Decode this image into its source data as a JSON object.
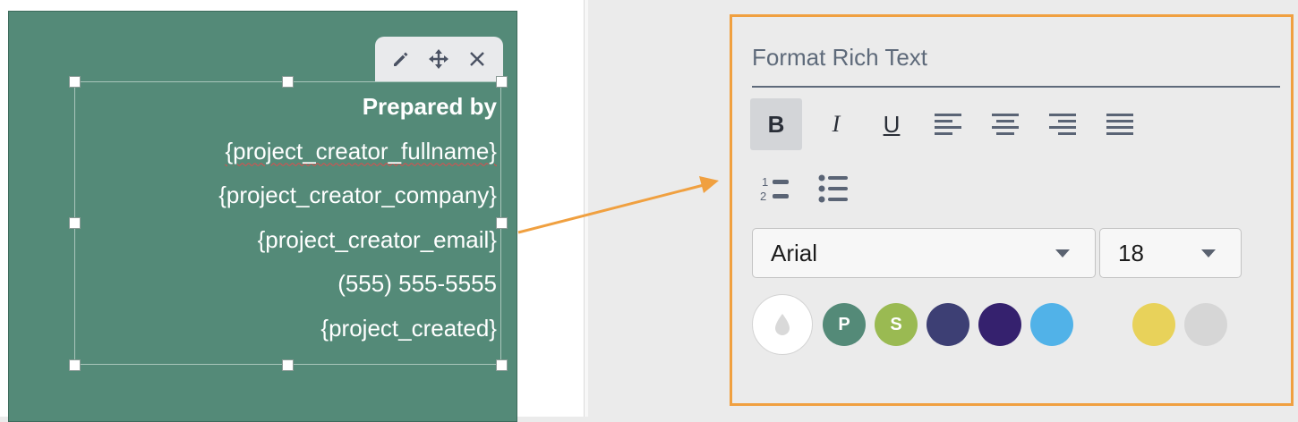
{
  "slide": {
    "toolbar": {
      "edit_icon": "pencil-icon",
      "move_icon": "move-icon",
      "close_icon": "close-icon"
    },
    "lines": [
      "Prepared by",
      "{project_creator_fullname}",
      "{project_creator_company}",
      "{project_creator_email}",
      "(555) 555-5555",
      "{project_created}"
    ],
    "background_color": "#548a78"
  },
  "panel": {
    "title": "Format Rich Text",
    "format_buttons": {
      "bold": "B",
      "italic": "I",
      "underline": "U",
      "align_left": "align-left-icon",
      "align_center": "align-center-icon",
      "align_right": "align-right-icon",
      "justify": "align-justify-icon",
      "ordered_list": "ordered-list-icon",
      "bullet_list": "bullet-list-icon"
    },
    "font": {
      "value": "Arial"
    },
    "size": {
      "value": "18"
    },
    "swatches": [
      {
        "label": "",
        "color": "#ffffff",
        "icon": "droplet-icon"
      },
      {
        "label": "P",
        "color": "#548a78"
      },
      {
        "label": "S",
        "color": "#9aba52"
      },
      {
        "label": "",
        "color": "#3d3f74"
      },
      {
        "label": "",
        "color": "#35216e"
      },
      {
        "label": "",
        "color": "#51b2e8"
      },
      {
        "label": "",
        "color": "#e8d25a"
      },
      {
        "label": "",
        "color": "#d6d6d6"
      }
    ],
    "border_color": "#f0a040"
  }
}
